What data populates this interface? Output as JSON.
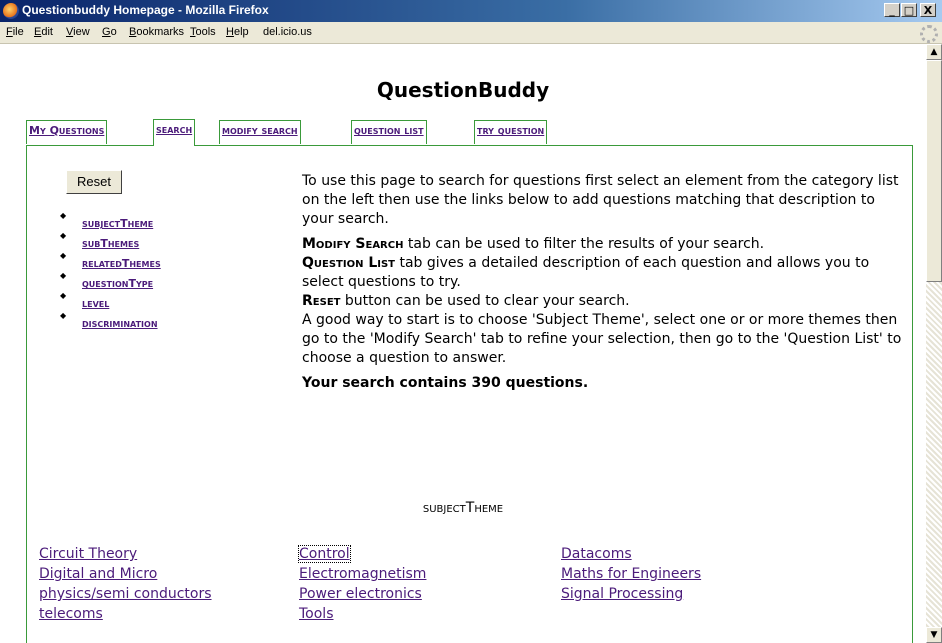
{
  "window": {
    "title": "Questionbuddy Homepage - Mozilla Firefox",
    "buttons": {
      "minimize": "_",
      "maximize": "□",
      "close": "X"
    }
  },
  "menu": {
    "items": [
      {
        "label": "File",
        "accel": "F",
        "rest": "ile"
      },
      {
        "label": "Edit",
        "accel": "E",
        "rest": "dit"
      },
      {
        "label": "View",
        "accel": "V",
        "rest": "iew"
      },
      {
        "label": "Go",
        "accel": "G",
        "rest": "o"
      },
      {
        "label": "Bookmarks",
        "accel": "B",
        "rest": "ookmarks"
      },
      {
        "label": "Tools",
        "accel": "T",
        "rest": "ools"
      },
      {
        "label": "Help",
        "accel": "H",
        "rest": "elp"
      },
      {
        "label": "del.icio.us",
        "accel": "",
        "rest": "del.icio.us"
      }
    ]
  },
  "page": {
    "title": "QuestionBuddy",
    "tabs": [
      "My Questions",
      "search",
      "modify search",
      "question list",
      "try question"
    ],
    "active_tab": "search",
    "reset_label": "Reset",
    "categories": [
      "subjectTheme",
      "subThemes",
      "relatedThemes",
      "questionType",
      "level",
      "discrimination"
    ],
    "intro": "To use this page to search for questions first select an element from the category list on the left then use the links below to add questions matching that description to your search.",
    "help": [
      {
        "term": "Modify Search",
        "text": " tab can be used to filter the results of your search."
      },
      {
        "term": "Question List",
        "text": " tab gives a detailed description of each question and allows you to select questions to try."
      },
      {
        "term": "Reset",
        "text": " button can be used to clear your search."
      }
    ],
    "tip": "A good way to start is to choose 'Subject Theme', select one or or more themes then go to the 'Modify Search' tab to refine your selection, then go to the 'Question List' to choose a question to answer.",
    "count_text": "Your search contains 390 questions.",
    "theme_heading": "subjectTheme",
    "themes": [
      [
        "Circuit Theory",
        "Digital and Micro",
        "physics/semi conductors",
        "telecoms"
      ],
      [
        "Control",
        "Electromagnetism",
        "Power electronics",
        "Tools"
      ],
      [
        "Datacoms",
        "Maths for Engineers",
        "Signal Processing"
      ]
    ]
  },
  "colors": {
    "link": "#4b1b7a",
    "tab_border": "#3a9a3a",
    "titlebar": "#0a246a"
  }
}
